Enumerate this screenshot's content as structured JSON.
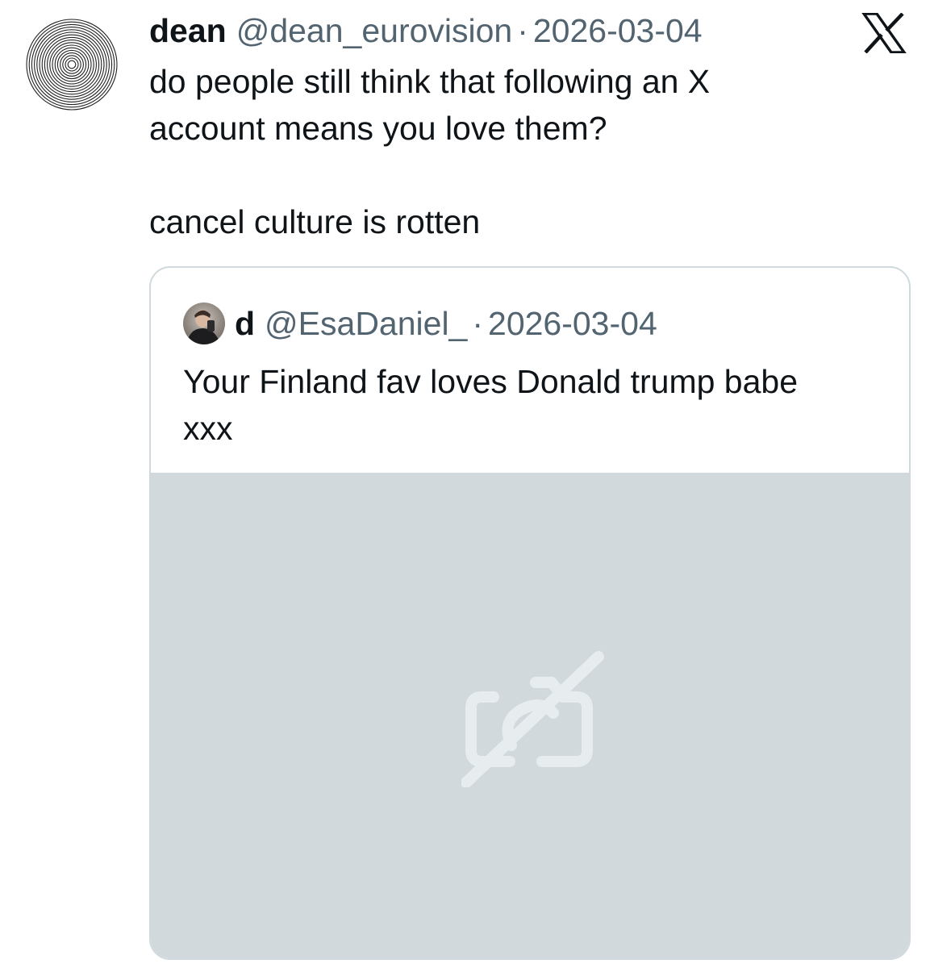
{
  "tweet": {
    "author": {
      "display_name": "dean",
      "handle": "@dean_eurovision",
      "avatar_icon": "concentric-circles-avatar-icon"
    },
    "separator": "·",
    "date": "2026-03-04",
    "text_lines": [
      "do people still think that following an X",
      "account means you love them?"
    ],
    "text_line_2": "cancel culture is rotten",
    "platform_icon": "x-logo-icon"
  },
  "quoted_tweet": {
    "author": {
      "display_name": "d",
      "handle": "@EsaDaniel_",
      "avatar_icon": "user-photo-avatar-icon"
    },
    "separator": "·",
    "date": "2026-03-04",
    "text_lines": [
      "Your Finland fav loves Donald trump babe",
      "xxx"
    ],
    "media": {
      "state": "unavailable",
      "icon": "camera-off-icon"
    }
  },
  "colors": {
    "text_primary": "#0f1419",
    "text_secondary": "#536471",
    "card_border": "#cfd9de",
    "media_placeholder": "#d1d9dd",
    "media_icon": "#e7ecef"
  }
}
